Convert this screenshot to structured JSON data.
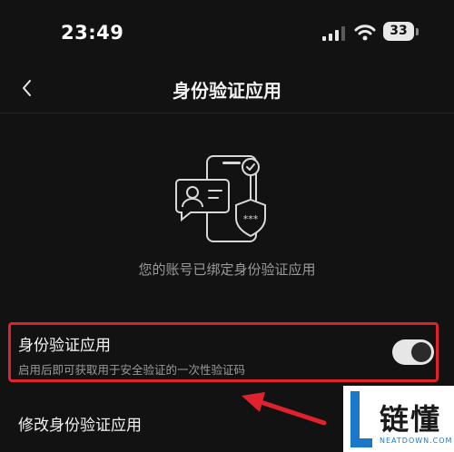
{
  "status_bar": {
    "time": "23:49",
    "battery": "33"
  },
  "nav": {
    "title": "身份验证应用",
    "back_icon": "chevron-left-icon"
  },
  "illustration": {
    "icon": "phone-id-shield-icon",
    "password_dots": "***"
  },
  "bound_status": "您的账号已绑定身份验证应用",
  "auth_setting": {
    "title": "身份验证应用",
    "description": "启用后即可获取用于安全验证的一次性验证码",
    "enabled": true
  },
  "modify": {
    "label": "修改身份验证应用"
  },
  "watermark": {
    "logo_letter": "L",
    "cn": "链懂",
    "en": "NEATDOWN.COM"
  },
  "colors": {
    "background": "#121212",
    "highlight": "#e0212e",
    "arrow": "#e0212e"
  }
}
